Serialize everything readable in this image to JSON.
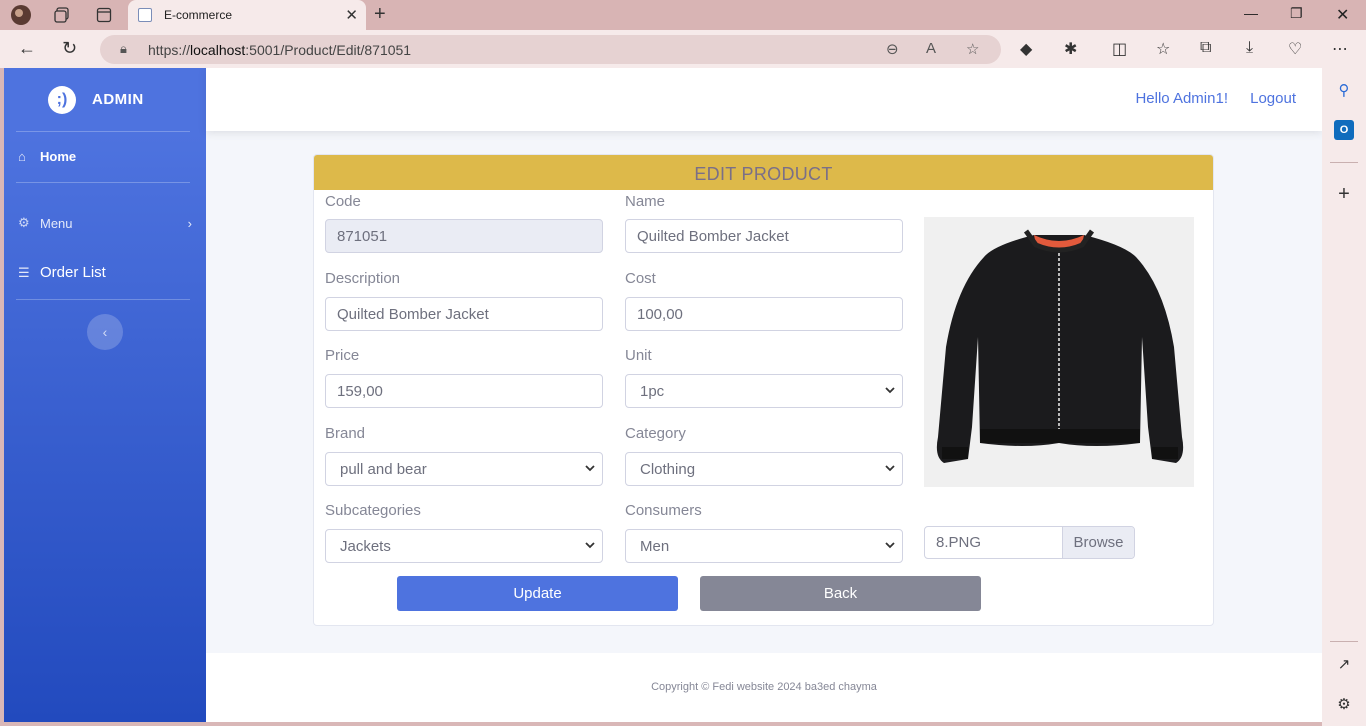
{
  "browser": {
    "tab_title": "E-commerce",
    "url_prefix": "https://",
    "url_host": "localhost",
    "url_rest": ":5001/Product/Edit/871051"
  },
  "sidebar": {
    "brand": "ADMIN",
    "home_label": "Home",
    "menu_label": "Menu",
    "orders_label": "Order List"
  },
  "topbar": {
    "greeting": "Hello Admin1!",
    "logout_label": "Logout"
  },
  "form": {
    "title": "EDIT PRODUCT",
    "code": {
      "label": "Code",
      "value": "871051"
    },
    "name": {
      "label": "Name",
      "value": "Quilted Bomber Jacket"
    },
    "description": {
      "label": "Description",
      "value": "Quilted Bomber Jacket"
    },
    "cost": {
      "label": "Cost",
      "value": "100,00"
    },
    "price": {
      "label": "Price",
      "value": "159,00"
    },
    "unit": {
      "label": "Unit",
      "value": "1pc"
    },
    "brand": {
      "label": "Brand",
      "value": "pull and bear"
    },
    "category": {
      "label": "Category",
      "value": "Clothing"
    },
    "subcategory": {
      "label": "Subcategories",
      "value": "Jackets"
    },
    "consumers": {
      "label": "Consumers",
      "value": "Men"
    },
    "file_name": "8.PNG",
    "browse_label": "Browse",
    "update_label": "Update",
    "back_label": "Back"
  },
  "footer": {
    "copyright": "Copyright © Fedi website 2024 ba3ed chayma"
  },
  "colors": {
    "primary": "#4e73df",
    "header_gold": "#ddb94a",
    "secondary": "#858796"
  }
}
